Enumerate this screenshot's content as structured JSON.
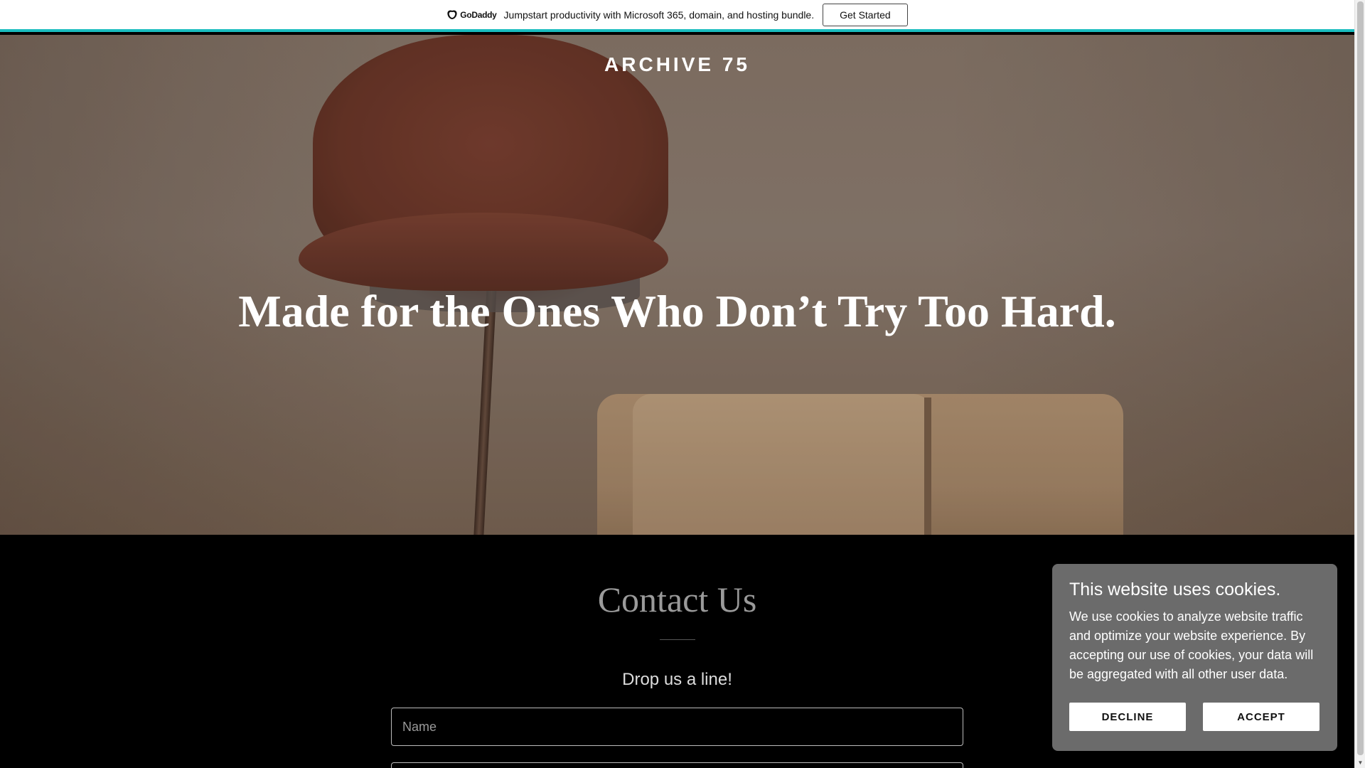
{
  "promo": {
    "logo_text": "GoDaddy",
    "message": "Jumpstart productivity with Microsoft 365, domain, and hosting bundle.",
    "button_label": "Get Started",
    "accent_color": "#1bbdbf"
  },
  "hero": {
    "site_title": "ARCHIVE 75",
    "tagline": "Made for the Ones Who Don’t Try Too Hard."
  },
  "contact": {
    "heading": "Contact Us",
    "subheading": "Drop us a line!",
    "name_placeholder": "Name",
    "email_placeholder": ""
  },
  "cookie": {
    "title": "This website uses cookies.",
    "body": "We use cookies to analyze website traffic and optimize your website experience. By accepting our use of cookies, your data will be aggregated with all other user data.",
    "decline_label": "DECLINE",
    "accept_label": "ACCEPT"
  }
}
